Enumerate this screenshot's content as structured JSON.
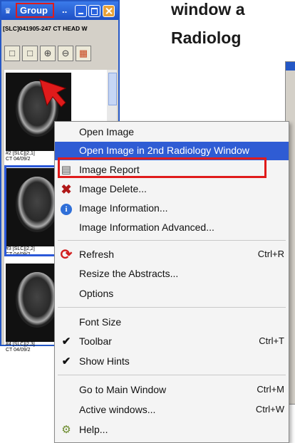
{
  "viewer": {
    "title": "Group",
    "title_dots": "..",
    "study_line": "[SLC]041905-247  CT HEAD W",
    "thumb_captions": [
      [
        "#2 [SLC][2,1]",
        "CT 04/09/2"
      ],
      [
        "#3 [SLC][2,2]",
        "CT 04/09/2"
      ],
      [
        "#4 [SLC][2,3]",
        "CT 04/09/2"
      ]
    ],
    "toolbar_icons": [
      "book-icon",
      "book-icon",
      "zoom-in-icon",
      "zoom-out-icon",
      "layout-icon"
    ]
  },
  "overlay": {
    "line1": "window a",
    "line2": "Radiolog"
  },
  "context_menu": {
    "items": [
      {
        "label": "Open Image",
        "shortcut": ""
      },
      {
        "label": "Open Image in 2nd Radiology Window",
        "shortcut": ""
      },
      {
        "label": "Image Report",
        "shortcut": ""
      },
      {
        "label": "Image Delete...",
        "shortcut": ""
      },
      {
        "label": "Image Information...",
        "shortcut": ""
      },
      {
        "label": "Image Information Advanced...",
        "shortcut": ""
      },
      {
        "label": "Refresh",
        "shortcut": "Ctrl+R"
      },
      {
        "label": "Resize the Abstracts...",
        "shortcut": ""
      },
      {
        "label": "Options",
        "shortcut": ""
      },
      {
        "label": "Font Size",
        "shortcut": ""
      },
      {
        "label": "Toolbar",
        "shortcut": "Ctrl+T"
      },
      {
        "label": "Show Hints",
        "shortcut": ""
      },
      {
        "label": "Go to Main Window",
        "shortcut": "Ctrl+M"
      },
      {
        "label": "Active windows...",
        "shortcut": "Ctrl+W"
      },
      {
        "label": "Help...",
        "shortcut": ""
      }
    ],
    "highlighted": "Open Image in 2nd Radiology Window",
    "checked": [
      "Toolbar",
      "Show Hints"
    ]
  },
  "colors": {
    "highlight": "#2f5cd4",
    "annotation_red": "#e01b1b",
    "title_blue": "#2457c5"
  }
}
